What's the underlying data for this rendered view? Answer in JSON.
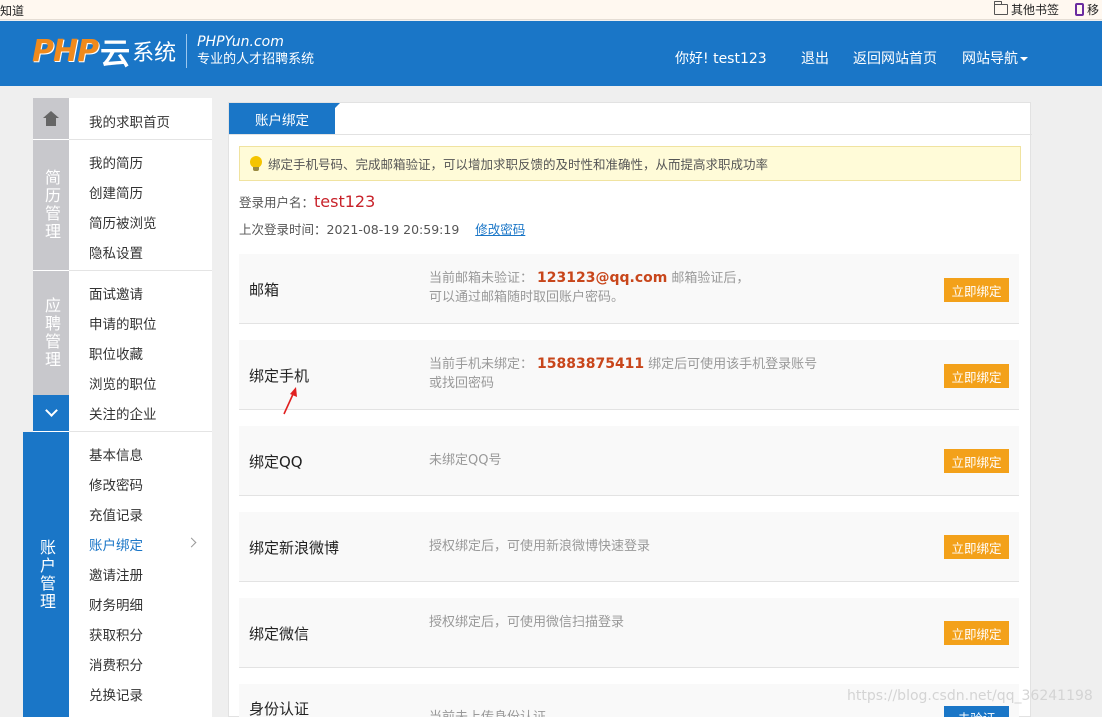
{
  "browser": {
    "left_text": "知道",
    "bookmark_folder": "其他书签",
    "bookmark_mobile": "移"
  },
  "header": {
    "logo_php": "PHP",
    "logo_yun": "云",
    "logo_sys": "系统",
    "logo_domain": "PHPYun.com",
    "logo_tagline": "专业的人才招聘系统",
    "greeting": "你好!",
    "username": "test123",
    "logout": "退出",
    "back_home": "返回网站首页",
    "site_nav": "网站导航"
  },
  "sidebar": {
    "home_item": "我的求职首页",
    "categories": [
      {
        "label": "简历管理"
      },
      {
        "label": "应聘管理"
      },
      {
        "label": "账户管理"
      }
    ],
    "resume_items": [
      "我的简历",
      "创建简历",
      "简历被浏览",
      "隐私设置"
    ],
    "apply_items": [
      "面试邀请",
      "申请的职位",
      "职位收藏",
      "浏览的职位",
      "关注的企业"
    ],
    "account_items": [
      "基本信息",
      "修改密码",
      "充值记录",
      "账户绑定",
      "邀请注册",
      "财务明细",
      "获取积分",
      "消费积分",
      "兑换记录"
    ]
  },
  "main": {
    "tab": "账户绑定",
    "notice": "绑定手机号码、完成邮箱验证，可以增加求职反馈的及时性和准确性，从而提高求职成功率",
    "login_user_label": "登录用户名：",
    "login_user": "test123",
    "last_login_label": "上次登录时间：",
    "last_login": "2021-08-19 20:59:19",
    "change_password": "修改密码",
    "bindings": [
      {
        "title": "邮箱",
        "desc_pre": "当前邮箱未验证：",
        "highlight": "123123@qq.com",
        "desc_post": "邮箱验证后，",
        "desc_line2": "可以通过邮箱随时取回账户密码。",
        "button": "立即绑定"
      },
      {
        "title": "绑定手机",
        "desc_pre": "当前手机未绑定：",
        "highlight": "15883875411",
        "desc_post": "绑定后可使用该手机登录账号",
        "desc_line2": "或找回密码",
        "button": "立即绑定"
      },
      {
        "title": "绑定QQ",
        "desc_pre": "未绑定QQ号",
        "button": "立即绑定"
      },
      {
        "title": "绑定新浪微博",
        "desc_pre": "授权绑定后，可使用新浪微博快速登录",
        "button": "立即绑定"
      },
      {
        "title": "绑定微信",
        "desc_pre": "授权绑定后，可使用微信扫描登录",
        "button": "立即绑定"
      },
      {
        "title": "身份认证",
        "desc_pre": "当前未上传身份认证",
        "button": "去验证"
      }
    ]
  },
  "watermark": "https://blog.csdn.net/qq_36241198",
  "colors": {
    "brand_blue": "#1a76c7",
    "bind_orange": "#f3a11a",
    "highlight_red": "#c8461b"
  }
}
